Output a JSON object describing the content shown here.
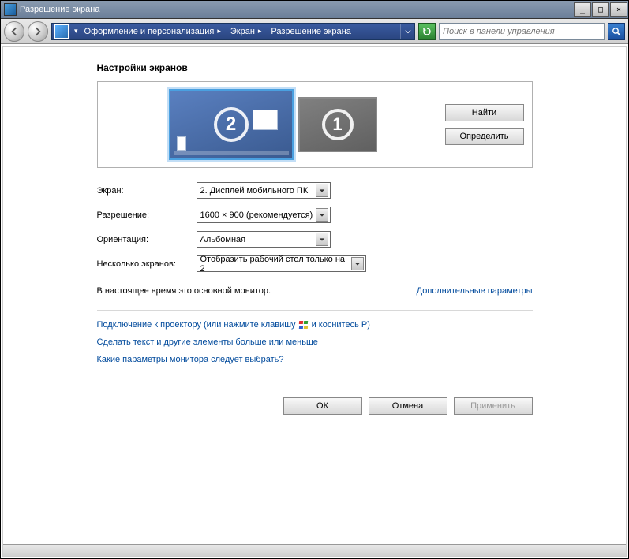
{
  "window": {
    "title": "Разрешение экрана",
    "minimize": "_",
    "maximize": "□",
    "close": "×"
  },
  "nav": {
    "breadcrumb": {
      "root_dropdown": "▾",
      "item1": "Оформление и персонализация",
      "item2": "Экран",
      "item3": "Разрешение экрана"
    }
  },
  "search": {
    "placeholder": "Поиск в панели управления"
  },
  "main": {
    "heading": "Настройки экранов",
    "monitors": {
      "selected_number": "2",
      "other_number": "1"
    },
    "side_buttons": {
      "find": "Найти",
      "detect": "Определить"
    },
    "form": {
      "screen_label": "Экран:",
      "screen_value": "2. Дисплей мобильного ПК",
      "resolution_label": "Разрешение:",
      "resolution_value": "1600 × 900 (рекомендуется)",
      "orientation_label": "Ориентация:",
      "orientation_value": "Альбомная",
      "multiple_label": "Несколько экранов:",
      "multiple_value": "Отобразить рабочий стол только на 2"
    },
    "status": {
      "primary_text": "В настоящее время это основной монитор.",
      "advanced_link": "Дополнительные параметры"
    },
    "links": {
      "projector_prefix": "Подключение к проектору (или нажмите клавишу",
      "projector_suffix": "и коснитесь P)",
      "text_size": "Сделать текст и другие элементы больше или меньше",
      "which_monitor": "Какие параметры монитора следует выбрать?"
    },
    "buttons": {
      "ok": "ОК",
      "cancel": "Отмена",
      "apply": "Применить"
    }
  }
}
